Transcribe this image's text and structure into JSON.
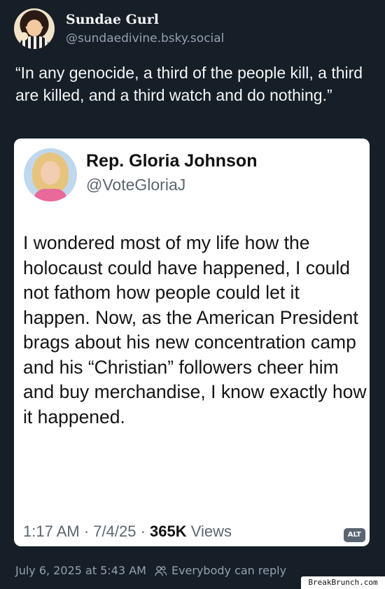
{
  "post": {
    "author": {
      "display_name": "Sundae Gurl",
      "handle": "@sundaedivine.bsky.social"
    },
    "text": "“In any genocide, a third of the people kill, a third are killed, and a third watch and do nothing.”",
    "timestamp": "July 6, 2025 at 5:43 AM",
    "reply_setting": "Everybody can reply"
  },
  "embedded_image": {
    "author": {
      "display_name": "Rep. Gloria Johnson",
      "handle": "@VoteGloriaJ"
    },
    "body": "I wondered most of my life how the holocaust could have happened, I could not fathom how people could let it happen. Now, as the American President brags about his new concentration camp and his “Christian” followers cheer him and buy merchandise, I know exactly how it happened.",
    "time": "1:17 AM",
    "separator": " · ",
    "date": "7/4/25",
    "views_count": "365K",
    "views_label": "Views",
    "alt_badge": "ALT"
  },
  "watermark": "BreakBrunch.com",
  "icons": {
    "avatar": "avatar-icon",
    "people": "people-icon"
  },
  "colors": {
    "background": "#161e27",
    "muted": "#93a1b1",
    "card": "#ffffff"
  }
}
